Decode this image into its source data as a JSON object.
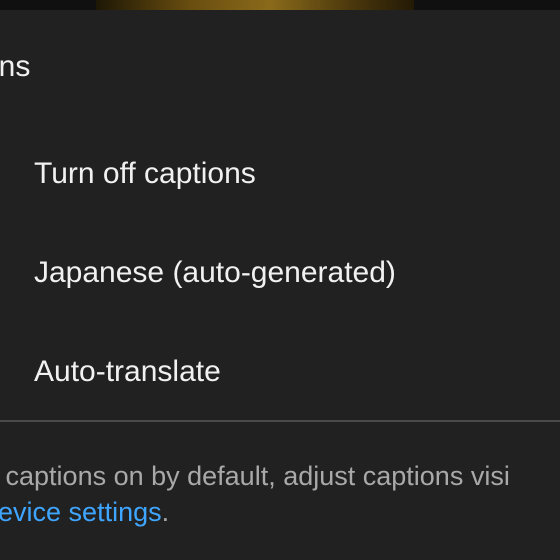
{
  "sheet": {
    "title": "ons",
    "items": [
      {
        "label": "Turn off captions"
      },
      {
        "label": "Japanese (auto-generated)"
      },
      {
        "label": "Auto-translate"
      }
    ],
    "footer": {
      "line1": "p captions on by default, adjust captions visi",
      "line2_link": "device settings",
      "line2_end": "."
    }
  },
  "colors": {
    "sheet_background": "#212121",
    "text": "#f1f1f1",
    "secondary_text": "#a9a9a9",
    "link": "#3ea6ff",
    "divider": "#4a4a4a"
  }
}
